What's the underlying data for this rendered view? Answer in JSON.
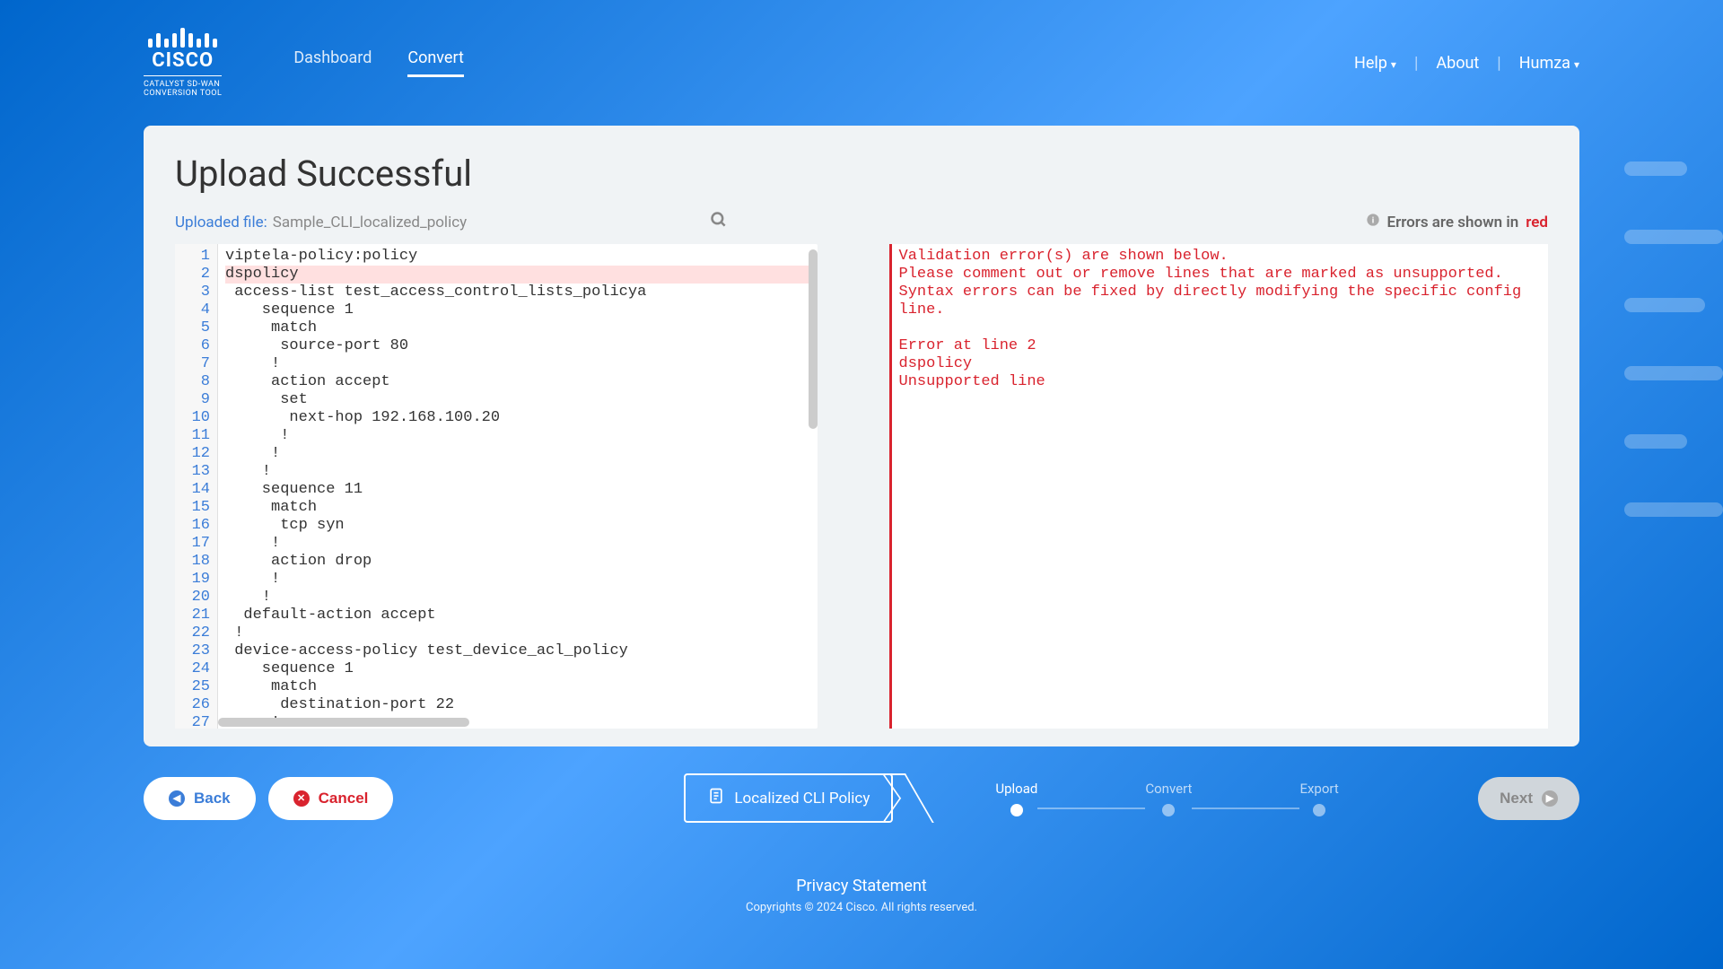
{
  "brand": {
    "name": "CISCO",
    "sub": "CATALYST SD-WAN\nCONVERSION TOOL"
  },
  "nav": {
    "dashboard": "Dashboard",
    "convert": "Convert",
    "help": "Help",
    "about": "About",
    "user": "Humza"
  },
  "page": {
    "title": "Upload Successful",
    "uploaded_label": "Uploaded file:",
    "uploaded_file": "Sample_CLI_localized_policy",
    "error_notice_prefix": "Errors are shown in",
    "error_notice_red": "red"
  },
  "code_lines": [
    "viptela-policy:policy",
    "dspolicy",
    " access-list test_access_control_lists_policya",
    "    sequence 1",
    "     match",
    "      source-port 80",
    "     !",
    "     action accept",
    "      set",
    "       next-hop 192.168.100.20",
    "      !",
    "     !",
    "    !",
    "    sequence 11",
    "     match",
    "      tcp syn",
    "     !",
    "     action drop",
    "     !",
    "    !",
    "  default-action accept",
    " !",
    " device-access-policy test_device_acl_policy",
    "    sequence 1",
    "     match",
    "      destination-port 22",
    "     !"
  ],
  "error_line_index": 1,
  "error_text": "Validation error(s) are shown below.\nPlease comment out or remove lines that are marked as unsupported. Syntax errors can be fixed by directly modifying the specific config line.\n\nError at line 2\ndspolicy\nUnsupported line",
  "breadcrumb": "Localized CLI Policy",
  "steps": [
    {
      "label": "Upload",
      "active": true
    },
    {
      "label": "Convert",
      "active": false
    },
    {
      "label": "Export",
      "active": false
    }
  ],
  "buttons": {
    "back": "Back",
    "cancel": "Cancel",
    "next": "Next"
  },
  "footer": {
    "privacy": "Privacy Statement",
    "copy": "Copyrights © 2024 Cisco. All rights reserved."
  }
}
